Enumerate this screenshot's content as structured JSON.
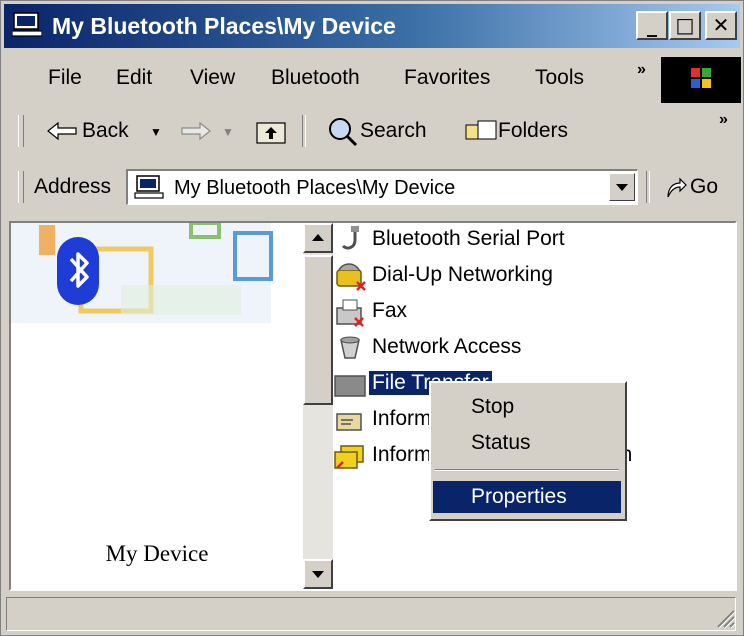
{
  "window": {
    "title": "My Bluetooth Places\\My Device"
  },
  "title_buttons": {
    "minimize": "_",
    "maximize": "□",
    "close": "✕"
  },
  "menu": {
    "items": [
      "File",
      "Edit",
      "View",
      "Bluetooth",
      "Favorites",
      "Tools"
    ],
    "overflow": "»"
  },
  "toolbar": {
    "back": "Back",
    "search": "Search",
    "folders": "Folders",
    "overflow": "»"
  },
  "address": {
    "label": "Address",
    "value": "My Bluetooth Places\\My Device",
    "go": "Go"
  },
  "left_pane": {
    "device_name": "My Device"
  },
  "services": [
    {
      "label": "Bluetooth Serial Port",
      "icon": "serial-port-icon"
    },
    {
      "label": "Dial-Up Networking",
      "icon": "dialup-icon"
    },
    {
      "label": "Fax",
      "icon": "fax-icon"
    },
    {
      "label": "Network Access",
      "icon": "network-access-icon"
    },
    {
      "label": "File Transfer",
      "icon": "file-transfer-icon",
      "selected": true
    },
    {
      "label": "Information Exchange",
      "icon": "info-exchange-icon"
    },
    {
      "label": "Information Synchronization",
      "icon": "info-sync-icon"
    }
  ],
  "context_menu": {
    "items": [
      "Stop",
      "Status",
      "Properties"
    ],
    "highlighted": "Properties"
  },
  "colors": {
    "title_start": "#0a246a",
    "title_end": "#a6caf0",
    "selection": "#0a246a",
    "bluetooth_blue": "#1f3cd6"
  }
}
